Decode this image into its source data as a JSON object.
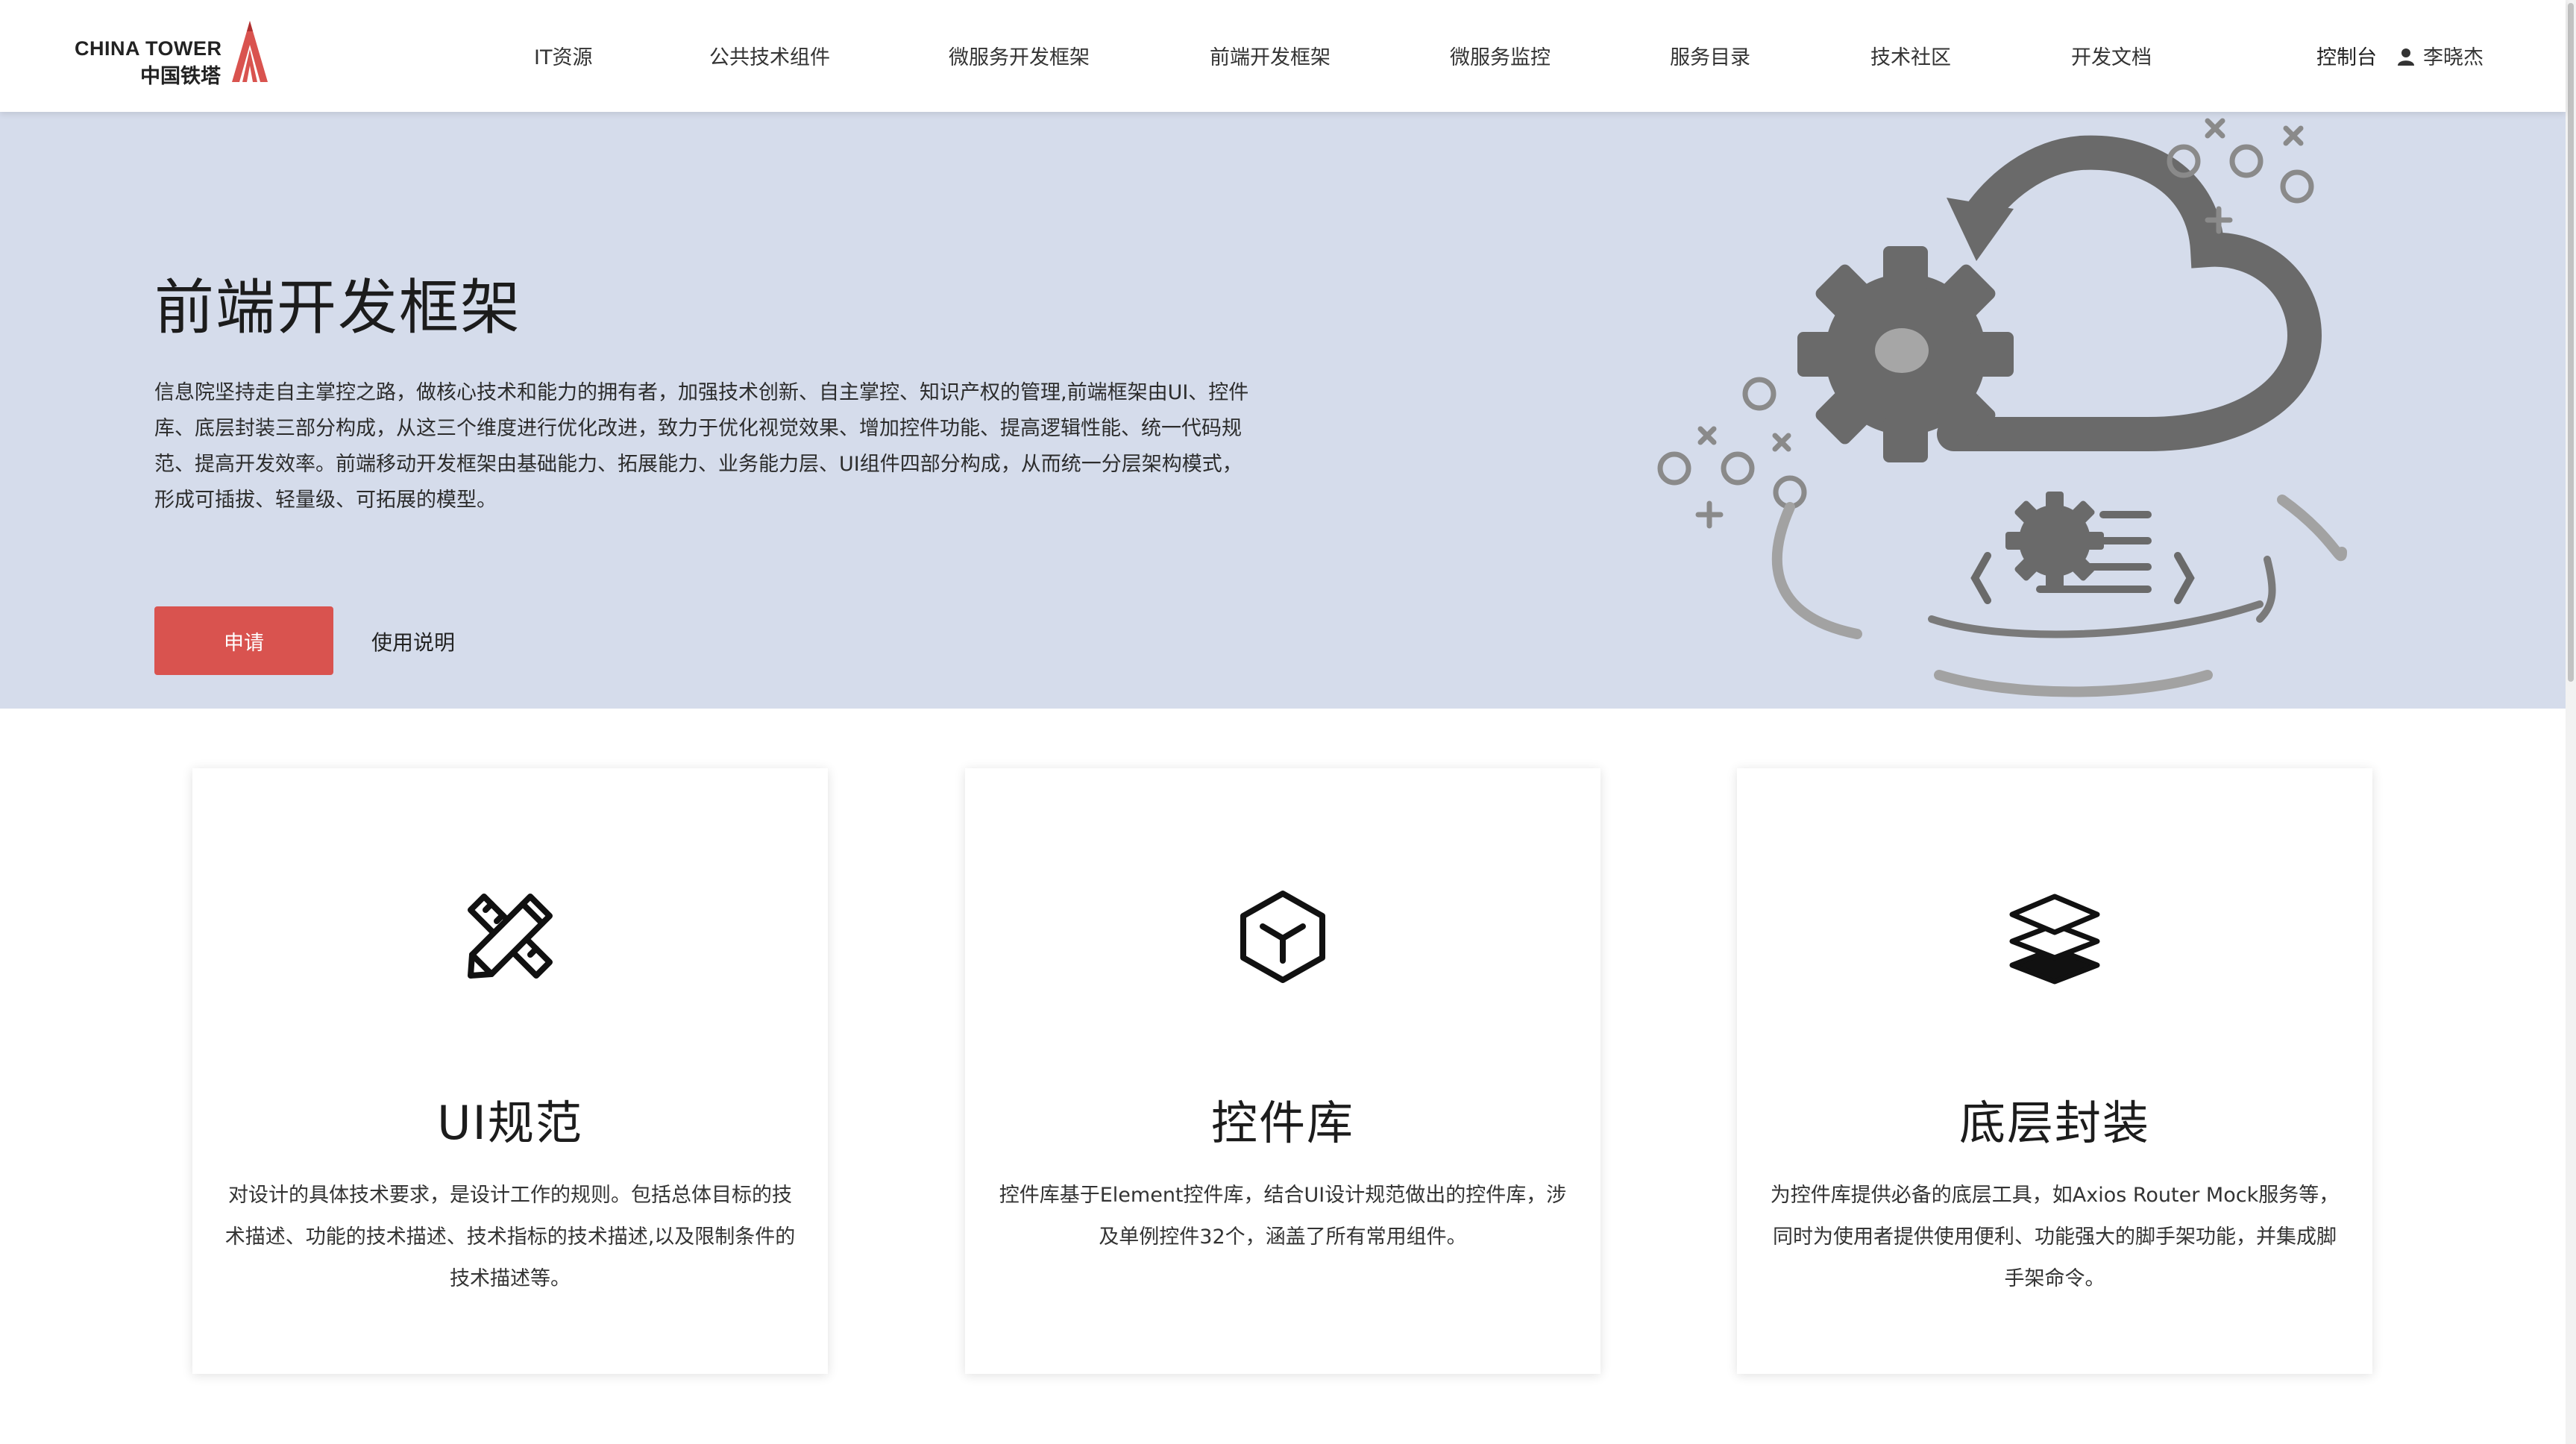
{
  "brand": {
    "name_en": "CHINA TOWER",
    "name_cn": "中国铁塔",
    "accent_color": "#d9534f"
  },
  "nav": {
    "items": [
      {
        "label": "IT资源"
      },
      {
        "label": "公共技术组件"
      },
      {
        "label": "微服务开发框架"
      },
      {
        "label": "前端开发框架"
      },
      {
        "label": "微服务监控"
      },
      {
        "label": "服务目录"
      },
      {
        "label": "技术社区"
      },
      {
        "label": "开发文档"
      }
    ],
    "console_label": "控制台",
    "user_icon": "user-icon",
    "user_name": "李晓杰"
  },
  "hero": {
    "title": "前端开发框架",
    "description": "信息院坚持走自主掌控之路，做核心技术和能力的拥有者，加强技术创新、自主掌控、知识产权的管理,前端框架由UI、控件库、底层封装三部分构成，从这三个维度进行优化改进，致力于优化视觉效果、增加控件功能、提高逻辑性能、统一代码规范、提高开发效率。前端移动开发框架由基础能力、拓展能力、业务能力层、UI组件四部分构成，从而统一分层架构模式，形成可插拔、轻量级、可拓展的模型。",
    "apply_label": "申请",
    "usage_label": "使用说明",
    "illustration_icon": "cloud-gear-icon",
    "background_color": "#d5dceb"
  },
  "cards": [
    {
      "icon": "pencil-ruler-icon",
      "title": "UI规范",
      "description": "对设计的具体技术要求，是设计工作的规则。包括总体目标的技术描述、功能的技术描述、技术指标的技术描述,以及限制条件的技术描述等。"
    },
    {
      "icon": "cube-icon",
      "title": "控件库",
      "description": "控件库基于Element控件库，结合UI设计规范做出的控件库，涉及单例控件32个，涵盖了所有常用组件。"
    },
    {
      "icon": "layers-icon",
      "title": "底层封装",
      "description": "为控件库提供必备的底层工具，如Axios Router Mock服务等，同时为使用者提供使用便利、功能强大的脚手架功能，并集成脚手架命令。"
    }
  ]
}
